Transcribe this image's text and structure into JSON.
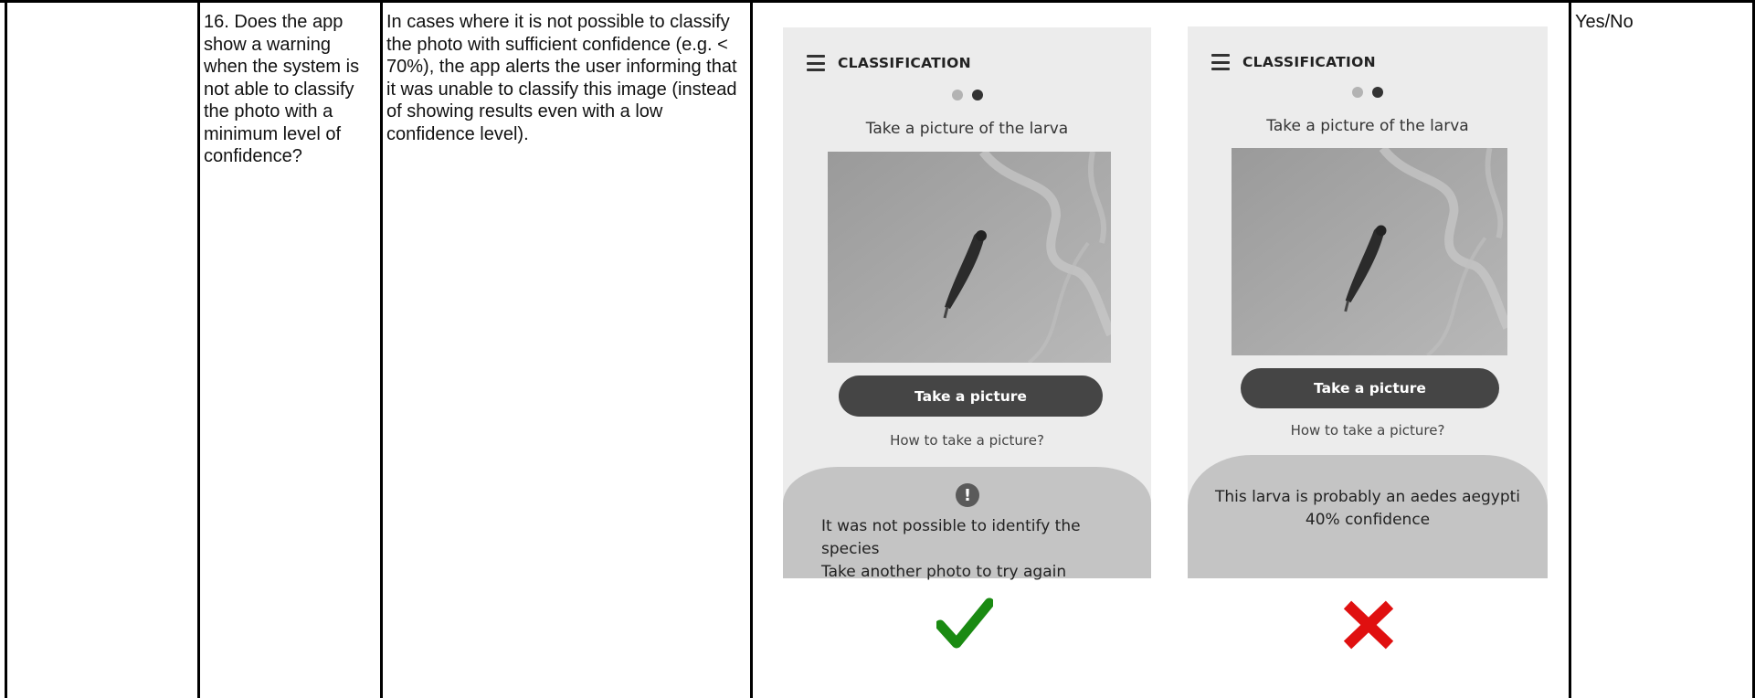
{
  "row": {
    "question": "16. Does the app show a warning when the system is not able to classify the photo with a minimum level of confidence?",
    "description": "In cases where it is not possible to classify the photo with sufficient confidence (e.g. < 70%), the app alerts the user informing that it was unable to classify this image (instead of showing results even with a low confidence level).",
    "answer_type": "Yes/No"
  },
  "examples": [
    {
      "header_title": "CLASSIFICATION",
      "instruction": "Take a picture of the larva",
      "button_label": "Take a picture",
      "help_link": "How to take a picture?",
      "alert_icon": "!",
      "result_lines": [
        "It was not possible to identify the species",
        "Take another photo to try again"
      ],
      "verdict": "correct",
      "verdict_icon": "check-icon",
      "verdict_color": "#1a8a12"
    },
    {
      "header_title": "CLASSIFICATION",
      "instruction": "Take a picture of the larva",
      "button_label": "Take a picture",
      "help_link": "How to take a picture?",
      "result_lines": [
        "This larva is probably an aedes aegypti",
        "40% confidence"
      ],
      "verdict": "incorrect",
      "verdict_icon": "cross-icon",
      "verdict_color": "#e01010"
    }
  ],
  "colors": {
    "phone_bg": "#ececec",
    "result_bg": "#c4c4c4",
    "button_bg": "#454545"
  }
}
